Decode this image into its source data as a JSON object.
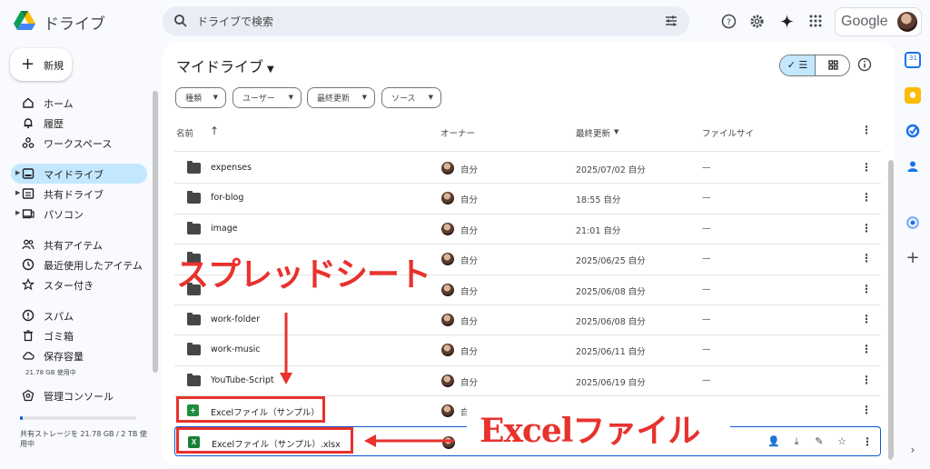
{
  "header": {
    "app_title": "ドライブ",
    "search_placeholder": "ドライブで検索",
    "account_brand": "Google"
  },
  "nav": {
    "new_label": "新規",
    "items": [
      {
        "label": "ホーム",
        "icon": "home-icon"
      },
      {
        "label": "履歴",
        "icon": "bell-icon"
      },
      {
        "label": "ワークスペース",
        "icon": "workspaces-icon"
      },
      {
        "label": "マイドライブ",
        "icon": "my-drive-icon",
        "active": true
      },
      {
        "label": "共有ドライブ",
        "icon": "shared-drive-icon"
      },
      {
        "label": "パソコン",
        "icon": "computer-icon"
      },
      {
        "label": "共有アイテム",
        "icon": "people-icon"
      },
      {
        "label": "最近使用したアイテム",
        "icon": "clock-icon"
      },
      {
        "label": "スター付き",
        "icon": "star-icon"
      },
      {
        "label": "スパム",
        "icon": "spam-icon"
      },
      {
        "label": "ゴミ箱",
        "icon": "trash-icon"
      },
      {
        "label": "保存容量",
        "icon": "cloud-icon"
      },
      {
        "label": "管理コンソール",
        "icon": "admin-icon"
      }
    ],
    "storage_used_small": "21.78 GB 使用中",
    "storage_text": "共有ストレージを 21.78 GB / 2 TB 使用中",
    "storage_fraction": 0.011
  },
  "main": {
    "title": "マイドライブ",
    "filters": [
      "種類",
      "ユーザー",
      "最終更新",
      "ソース"
    ],
    "columns": {
      "name": "名前",
      "owner": "オーナー",
      "modified": "最終更新",
      "size": "ファイルサイ"
    },
    "rows": [
      {
        "name": "expenses",
        "type": "folder",
        "owner": "自分",
        "modified": "2025/07/02 自分",
        "size": "—"
      },
      {
        "name": "for-blog",
        "type": "folder",
        "owner": "自分",
        "modified": "18:55 自分",
        "size": "—"
      },
      {
        "name": "image",
        "type": "folder",
        "owner": "自分",
        "modified": "21:01 自分",
        "size": "—"
      },
      {
        "name": "",
        "type": "folder",
        "owner": "自分",
        "modified": "2025/06/25 自分",
        "size": "—"
      },
      {
        "name": "",
        "type": "folder",
        "owner": "自分",
        "modified": "2025/06/08 自分",
        "size": "—"
      },
      {
        "name": "work-folder",
        "type": "folder",
        "owner": "自分",
        "modified": "2025/06/08 自分",
        "size": "—"
      },
      {
        "name": "work-music",
        "type": "folder",
        "owner": "自分",
        "modified": "2025/06/11 自分",
        "size": "—"
      },
      {
        "name": "YouTube-Script",
        "type": "folder",
        "owner": "自分",
        "modified": "2025/06/19 自分",
        "size": "—"
      },
      {
        "name": "Excelファイル（サンプル）",
        "type": "sheet",
        "owner": "自",
        "modified": "",
        "size": ""
      },
      {
        "name": "Excelファイル（サンプル）.xlsx",
        "type": "xlsx",
        "owner": "",
        "modified": "",
        "size": ""
      }
    ]
  },
  "annotations": {
    "spreadsheet": "スプレッドシート",
    "excel": "Excelファイル"
  },
  "colors": {
    "accent": "#0b57d0",
    "active_nav": "#c2e7ff",
    "annotation": "#e8322d",
    "sheet_green": "#1e8e3e"
  }
}
